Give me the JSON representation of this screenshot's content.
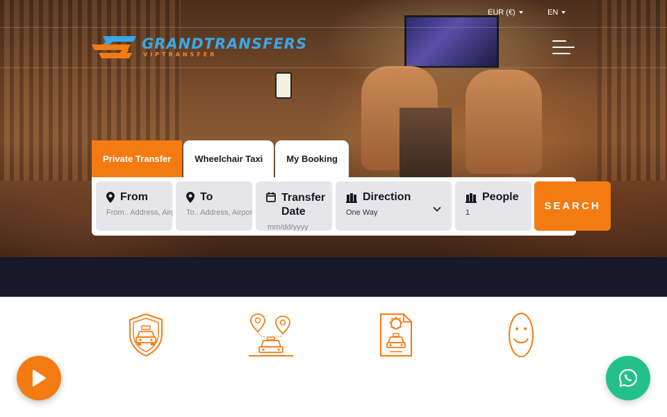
{
  "topbar": {
    "currency_label": "EUR (€)",
    "language_label": "EN"
  },
  "logo": {
    "title": "GRANDTRANSFERS",
    "subtitle": "VIPTRANSFER"
  },
  "tabs": [
    {
      "label": "Private Transfer",
      "active": true
    },
    {
      "label": "Wheelchair Taxi",
      "active": false
    },
    {
      "label": "My Booking",
      "active": false
    }
  ],
  "booking": {
    "from": {
      "label": "From",
      "placeholder": "From.. Address, Airport, Hotel..."
    },
    "to": {
      "label": "To",
      "placeholder": "To.. Address, Airport, Hotel..."
    },
    "date": {
      "label": "Transfer Date",
      "placeholder": "mm/dd/yyyy"
    },
    "direction": {
      "label": "Direction",
      "value": "One Way"
    },
    "people": {
      "label": "People",
      "value": "1"
    },
    "search_label": "SEARCH"
  },
  "features": [
    {
      "icon": "shield-taxi-icon"
    },
    {
      "icon": "taxi-locations-icon"
    },
    {
      "icon": "certificate-taxi-icon"
    },
    {
      "icon": "smiley-icon"
    }
  ],
  "colors": {
    "accent": "#f47b12",
    "dark_band": "#171828",
    "whatsapp": "#23c08a",
    "logo_blue": "#3aa7e8"
  }
}
